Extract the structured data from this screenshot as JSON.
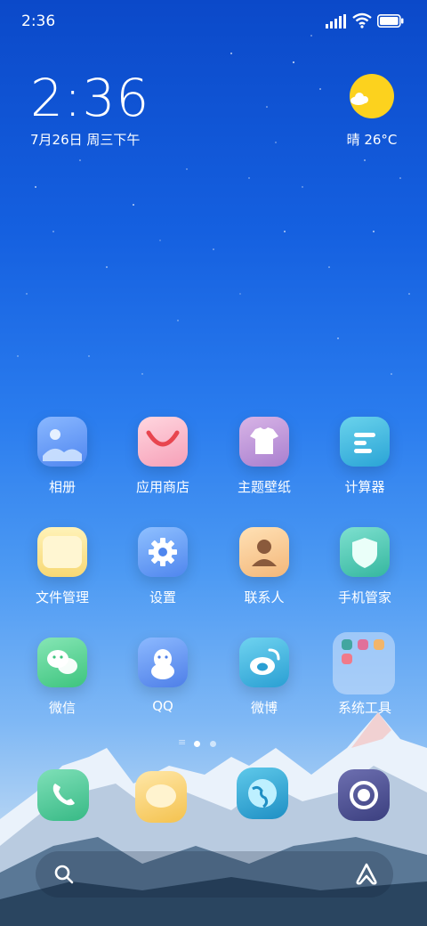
{
  "status_bar": {
    "time": "2:36"
  },
  "clock_widget": {
    "time": "2:36",
    "date": "7月26日 周三下午"
  },
  "weather_widget": {
    "text": "晴 26°C",
    "icon": "sun-cloud-icon"
  },
  "apps": [
    {
      "label": "相册",
      "icon": "gallery-icon"
    },
    {
      "label": "应用商店",
      "icon": "app-store-icon"
    },
    {
      "label": "主题壁纸",
      "icon": "themes-icon"
    },
    {
      "label": "计算器",
      "icon": "calculator-icon"
    },
    {
      "label": "文件管理",
      "icon": "file-manager-icon"
    },
    {
      "label": "设置",
      "icon": "settings-gear-icon"
    },
    {
      "label": "联系人",
      "icon": "contacts-icon"
    },
    {
      "label": "手机管家",
      "icon": "security-shield-icon"
    },
    {
      "label": "微信",
      "icon": "wechat-icon"
    },
    {
      "label": "QQ",
      "icon": "qq-penguin-icon"
    },
    {
      "label": "微博",
      "icon": "weibo-icon"
    },
    {
      "label": "系统工具",
      "icon": "folder-icon"
    }
  ],
  "page_indicator": {
    "pages": 2,
    "active": 1
  },
  "dock": [
    {
      "icon": "phone-icon"
    },
    {
      "icon": "messages-icon"
    },
    {
      "icon": "browser-globe-icon"
    },
    {
      "icon": "camera-icon"
    }
  ],
  "search_bar": {
    "left_icon": "search-icon",
    "right_icon": "assistant-icon"
  }
}
